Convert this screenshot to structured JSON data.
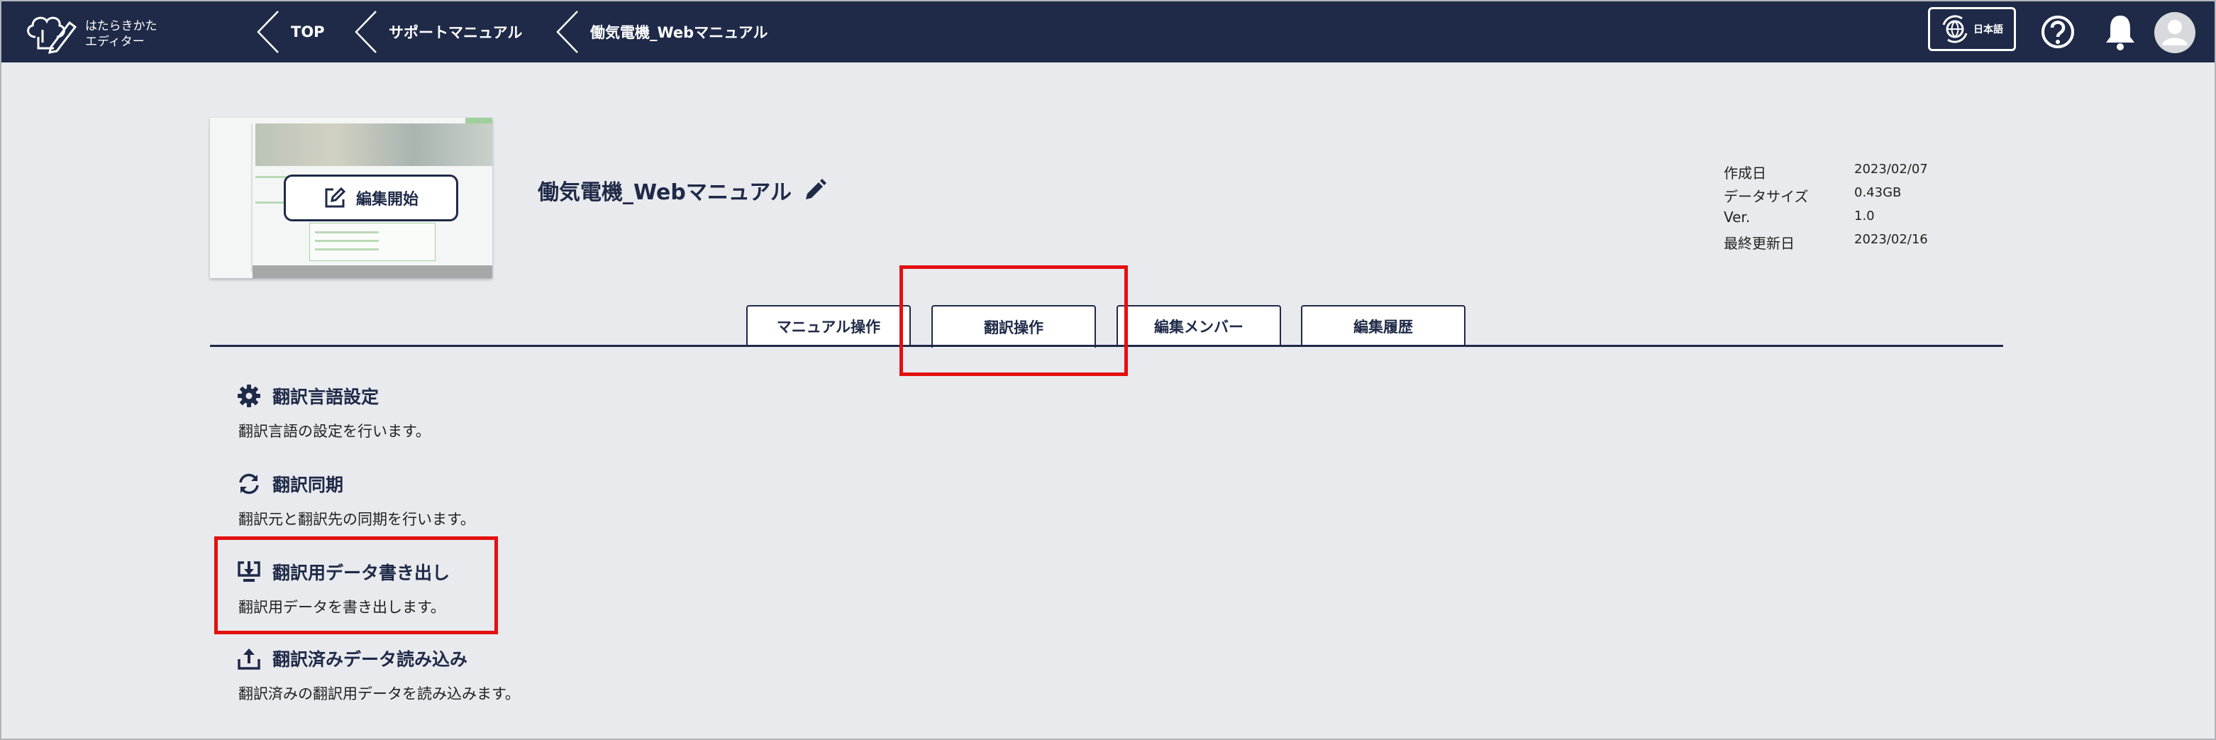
{
  "header": {
    "logo_text": "はたらきかた\nエディター",
    "breadcrumbs": [
      "TOP",
      "サポートマニュアル",
      "働気電機_Webマニュアル"
    ],
    "language_label": "日本語"
  },
  "project": {
    "edit_start_label": "編集開始",
    "title": "働気電機_Webマニュアル",
    "meta": [
      {
        "key": "作成日",
        "value": "2023/02/07"
      },
      {
        "key": "データサイズ",
        "value": "0.43GB"
      },
      {
        "key": "Ver.",
        "value": "1.0"
      },
      {
        "key": "最終更新日",
        "value": "2023/02/16"
      }
    ]
  },
  "tabs": [
    {
      "label": "マニュアル操作",
      "active": false
    },
    {
      "label": "翻訳操作",
      "active": true
    },
    {
      "label": "編集メンバー",
      "active": false
    },
    {
      "label": "編集履歴",
      "active": false
    }
  ],
  "items": [
    {
      "icon": "gear-icon",
      "title": "翻訳言語設定",
      "description": "翻訳言語の設定を行います。"
    },
    {
      "icon": "sync-icon",
      "title": "翻訳同期",
      "description": "翻訳元と翻訳先の同期を行います。"
    },
    {
      "icon": "download-icon",
      "title": "翻訳用データ書き出し",
      "description": "翻訳用データを書き出します。"
    },
    {
      "icon": "upload-icon",
      "title": "翻訳済みデータ読み込み",
      "description": "翻訳済みの翻訳用データを読み込みます。"
    }
  ],
  "colors": {
    "header_bg": "#1f2a48",
    "page_bg": "#e9eaee",
    "highlight": "#e31010"
  }
}
